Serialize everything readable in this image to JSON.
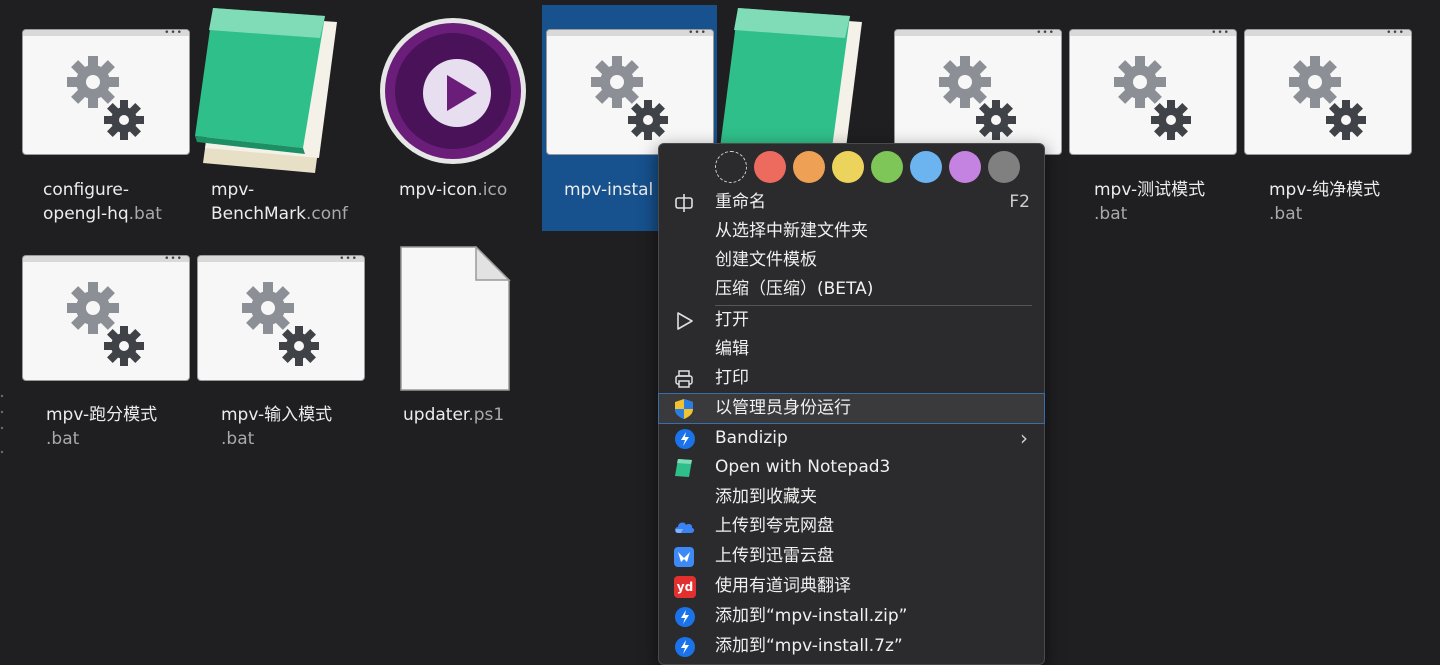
{
  "files": [
    {
      "name": "configure-",
      "name2": "opengl-hq",
      "ext": ".bat",
      "kind": "bat"
    },
    {
      "name": "mpv-",
      "name2": "BenchMark",
      "ext": ".conf",
      "kind": "notepad"
    },
    {
      "name": "mpv-icon",
      "name2": "",
      "ext": ".ico",
      "kind": "mpv"
    },
    {
      "name": "mpv-instal",
      "name2": "",
      "ext": "",
      "kind": "bat",
      "selected": true
    },
    {
      "name": "",
      "name2": "",
      "ext": "",
      "kind": "notepad"
    },
    {
      "name": "",
      "name2": "",
      "ext": "",
      "kind": "bat"
    },
    {
      "name": "mpv-测试模式",
      "name2": "",
      "ext": ".bat",
      "kind": "bat"
    },
    {
      "name": "mpv-纯净模式",
      "name2": "",
      "ext": ".bat",
      "kind": "bat"
    },
    {
      "name": "mpv-跑分模式",
      "name2": "",
      "ext": ".bat",
      "kind": "bat"
    },
    {
      "name": "mpv-输入模式",
      "name2": "",
      "ext": ".bat",
      "kind": "bat"
    },
    {
      "name": "updater",
      "name2": "",
      "ext": ".ps1",
      "kind": "doc"
    }
  ],
  "menu": {
    "tag_colors": [
      "none",
      "#ec6a5e",
      "#eea154",
      "#ecd35c",
      "#7dc657",
      "#6cb4f0",
      "#c483e0",
      "#808080"
    ],
    "items": [
      {
        "label": "重命名",
        "shortcut": "F2",
        "icon": "rename-icon"
      },
      {
        "label": "从选择中新建文件夹",
        "icon": ""
      },
      {
        "label": "创建文件模板",
        "icon": ""
      },
      {
        "label": "压缩（压缩）(BETA)",
        "icon": ""
      },
      {
        "label": "打开",
        "icon": "play-icon"
      },
      {
        "label": "编辑",
        "icon": ""
      },
      {
        "label": "打印",
        "icon": "printer-icon"
      },
      {
        "label": "以管理员身份运行",
        "icon": "uac-shield-icon"
      },
      {
        "label": "Bandizip",
        "icon": "bandizip-icon",
        "submenu": true
      },
      {
        "label": "Open with Notepad3",
        "icon": "notepad3-icon"
      },
      {
        "label": "添加到收藏夹",
        "icon": ""
      },
      {
        "label": "上传到夸克网盘",
        "icon": "quark-cloud-icon"
      },
      {
        "label": "上传到迅雷云盘",
        "icon": "xunlei-icon"
      },
      {
        "label": "使用有道词典翻译",
        "icon": "youdao-icon"
      },
      {
        "label": "添加到“mpv-install.zip”",
        "icon": "bandizip-icon"
      },
      {
        "label": "添加到“mpv-install.7z”",
        "icon": "bandizip-icon"
      }
    ],
    "youdao_badge": "yd",
    "submenu_arrow": "›"
  }
}
